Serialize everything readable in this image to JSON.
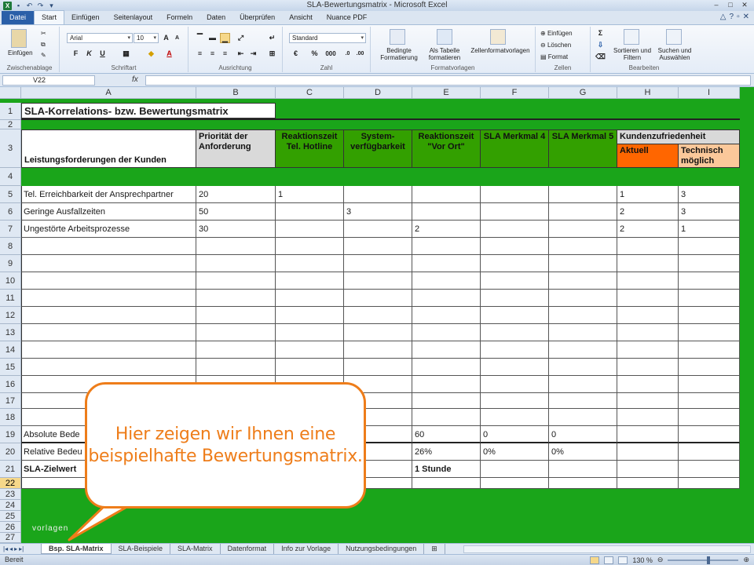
{
  "window": {
    "title": "SLA-Bewertungsmatrix - Microsoft Excel",
    "controls": [
      "–",
      "□",
      "✕"
    ]
  },
  "ribbon_tabs": [
    "Datei",
    "Start",
    "Einfügen",
    "Seitenlayout",
    "Formeln",
    "Daten",
    "Überprüfen",
    "Ansicht",
    "Nuance PDF"
  ],
  "ribbon": {
    "clipboard": {
      "paste_label": "Einfügen",
      "group_label": "Zwischenablage"
    },
    "font": {
      "font_name": "Arial",
      "font_size": "10",
      "group_label": "Schriftart",
      "bold": "F",
      "italic": "K",
      "underline": "U"
    },
    "alignment": {
      "group_label": "Ausrichtung"
    },
    "number": {
      "format": "Standard",
      "group_label": "Zahl",
      "percent": "%",
      "thousands": "000"
    },
    "styles": {
      "group_label": "Formatvorlagen",
      "conditional": "Bedingte Formatierung",
      "as_table": "Als Tabelle formatieren",
      "cell_styles": "Zellenformatvorlagen"
    },
    "cells": {
      "group_label": "Zellen",
      "insert": "Einfügen",
      "delete": "Löschen",
      "format": "Format"
    },
    "editing": {
      "group_label": "Bearbeiten",
      "sort": "Sortieren und Filtern",
      "find": "Suchen und Auswählen",
      "sum": "Σ"
    }
  },
  "formula_bar": {
    "name_box": "V22",
    "fx": "fx",
    "value": ""
  },
  "columns": [
    "A",
    "B",
    "C",
    "D",
    "E",
    "F",
    "G",
    "H",
    "I"
  ],
  "rows": [
    "1",
    "2",
    "3",
    "4",
    "5",
    "6",
    "7",
    "8",
    "9",
    "10",
    "11",
    "12",
    "13",
    "14",
    "15",
    "16",
    "17",
    "18",
    "19",
    "20",
    "21",
    "22",
    "23",
    "24",
    "25",
    "26",
    "27"
  ],
  "sheet": {
    "title": "SLA-Korrelations- bzw. Bewertungsmatrix",
    "header": {
      "a": "Leistungsforderungen der Kunden",
      "b": "Priorität der Anforderung",
      "c": "Reaktionszeit Tel. Hotline",
      "d": "System-verfügbarkeit",
      "e": "Reaktionszeit \"Vor Ort\"",
      "f": "SLA Merkmal 4",
      "g": "SLA Merkmal 5",
      "h_group": "Kundenzufriedenheit",
      "h": "Aktuell",
      "i": "Technisch möglich"
    },
    "data_rows": [
      {
        "a": "Tel. Erreichbarkeit der Ansprechpartner",
        "b": "20",
        "c": "1",
        "d": "",
        "e": "",
        "f": "",
        "g": "",
        "h": "1",
        "i": "3"
      },
      {
        "a": "Geringe Ausfallzeiten",
        "b": "50",
        "c": "",
        "d": "3",
        "e": "",
        "f": "",
        "g": "",
        "h": "2",
        "i": "3"
      },
      {
        "a": "Ungestörte Arbeitsprozesse",
        "b": "30",
        "c": "",
        "d": "",
        "e": "2",
        "f": "",
        "g": "",
        "h": "2",
        "i": "1"
      }
    ],
    "summary": {
      "abs_label": "Absolute Bede",
      "rel_label": "Relative Bedeu",
      "ziel_label": "SLA-Zielwert",
      "abs_e": "60",
      "abs_f": "0",
      "abs_g": "0",
      "rel_e": "26%",
      "rel_f": "0%",
      "rel_g": "0%",
      "ziel_e": "1 Stunde"
    }
  },
  "callout": {
    "line1": "Hier zeigen wir Ihnen eine",
    "line2": "beispielhafte Bewertungsmatrix."
  },
  "watermark": "vorlagen",
  "sheet_tabs": [
    "Bsp. SLA-Matrix",
    "SLA-Beispiele",
    "SLA-Matrix",
    "Datenformat",
    "Info zur Vorlage",
    "Nutzungsbedingungen"
  ],
  "status": {
    "text": "Bereit",
    "zoom": "130 %"
  },
  "colors": {
    "sheet_green": "#1aa51a",
    "header_green": "#33a000",
    "kz_orange": "#ff6600",
    "kz_peach": "#fbc89a",
    "callout_orange": "#ee7d1a"
  }
}
